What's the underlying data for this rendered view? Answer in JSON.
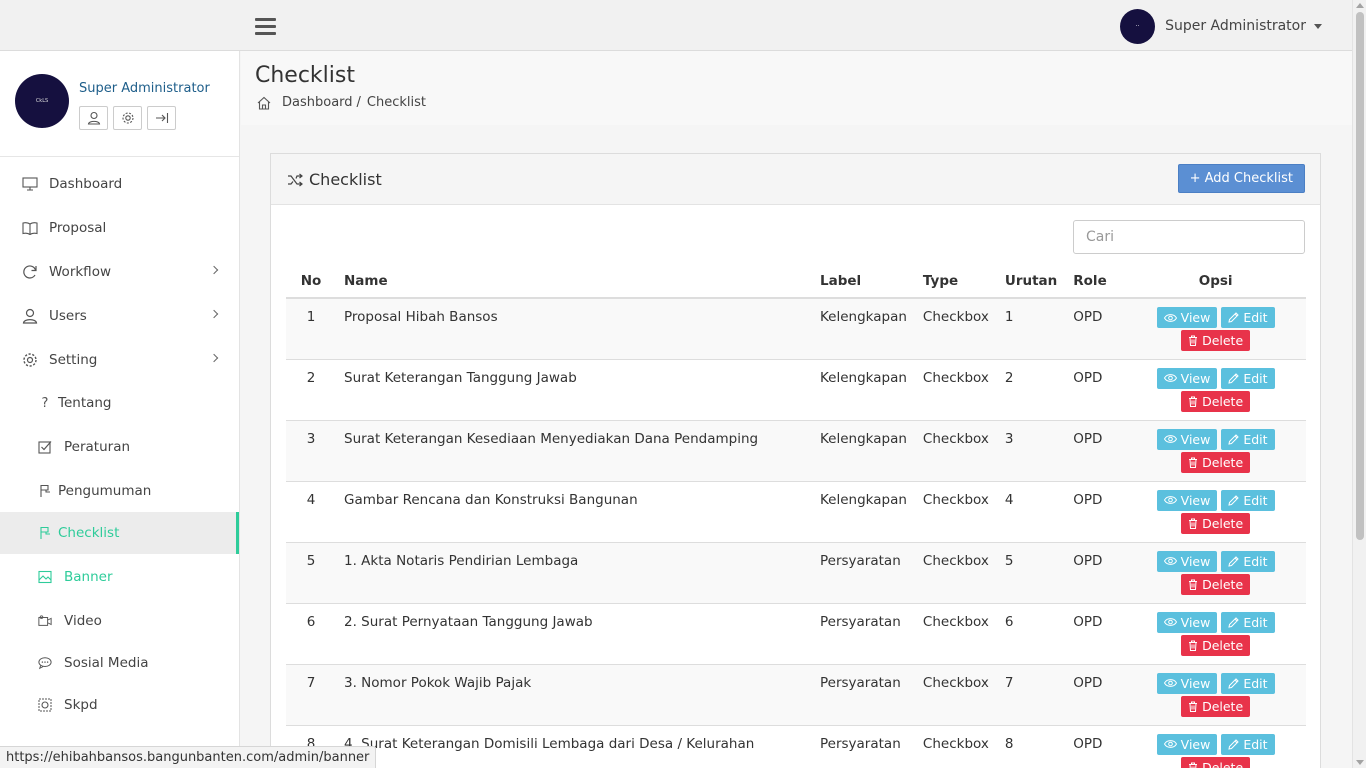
{
  "header": {
    "user_name": "Super Administrator",
    "avatar_text": "··"
  },
  "sidebar": {
    "profile_name": "Super Administrator",
    "avatar_text": "CkLS",
    "items": [
      {
        "label": "Dashboard",
        "icon": "monitor-icon"
      },
      {
        "label": "Proposal",
        "icon": "book-icon"
      },
      {
        "label": "Workflow",
        "icon": "refresh-icon",
        "has_children": true
      },
      {
        "label": "Users",
        "icon": "user-icon",
        "has_children": true
      },
      {
        "label": "Setting",
        "icon": "gear-icon",
        "has_children": true
      }
    ],
    "sub_items": [
      {
        "label": "Tentang",
        "icon": "question-icon"
      },
      {
        "label": "Peraturan",
        "icon": "checkbox-icon"
      },
      {
        "label": "Pengumuman",
        "icon": "flag-icon"
      },
      {
        "label": "Checklist",
        "icon": "flag-icon",
        "active": true
      },
      {
        "label": "Banner",
        "icon": "image-icon"
      },
      {
        "label": "Video",
        "icon": "video-icon"
      },
      {
        "label": "Sosial Media",
        "icon": "chat-icon"
      },
      {
        "label": "Skpd",
        "icon": "target-icon"
      }
    ]
  },
  "page": {
    "title": "Checklist",
    "breadcrumb": {
      "home": "Dashboard",
      "separator": "/",
      "current": "Checklist"
    }
  },
  "panel": {
    "title": "Checklist",
    "add_button": "+ Add Checklist",
    "search_placeholder": "Cari"
  },
  "table": {
    "headers": {
      "no": "No",
      "name": "Name",
      "label": "Label",
      "type": "Type",
      "urutan": "Urutan",
      "role": "Role",
      "opsi": "Opsi"
    },
    "action_labels": {
      "view": "View",
      "edit": "Edit",
      "delete": "Delete"
    },
    "rows": [
      {
        "no": "1",
        "name": "Proposal Hibah Bansos",
        "label": "Kelengkapan",
        "type": "Checkbox",
        "urutan": "1",
        "role": "OPD"
      },
      {
        "no": "2",
        "name": "Surat Keterangan Tanggung Jawab",
        "label": "Kelengkapan",
        "type": "Checkbox",
        "urutan": "2",
        "role": "OPD"
      },
      {
        "no": "3",
        "name": "Surat Keterangan Kesediaan Menyediakan Dana Pendamping",
        "label": "Kelengkapan",
        "type": "Checkbox",
        "urutan": "3",
        "role": "OPD"
      },
      {
        "no": "4",
        "name": "Gambar Rencana dan Konstruksi Bangunan",
        "label": "Kelengkapan",
        "type": "Checkbox",
        "urutan": "4",
        "role": "OPD"
      },
      {
        "no": "5",
        "name": "1. Akta Notaris Pendirian Lembaga",
        "label": "Persyaratan",
        "type": "Checkbox",
        "urutan": "5",
        "role": "OPD"
      },
      {
        "no": "6",
        "name": "2. Surat Pernyataan Tanggung Jawab",
        "label": "Persyaratan",
        "type": "Checkbox",
        "urutan": "6",
        "role": "OPD"
      },
      {
        "no": "7",
        "name": "3. Nomor Pokok Wajib Pajak",
        "label": "Persyaratan",
        "type": "Checkbox",
        "urutan": "7",
        "role": "OPD"
      },
      {
        "no": "8",
        "name": "4. Surat Keterangan Domisili Lembaga dari Desa / Kelurahan",
        "label": "Persyaratan",
        "type": "Checkbox",
        "urutan": "8",
        "role": "OPD"
      }
    ]
  },
  "status_bar": {
    "url": "https://ehibahbansos.bangunbanten.com/admin/banner"
  },
  "colors": {
    "accent": "#2ecc9a",
    "primary_button": "#5b8fd3",
    "info_button": "#5bc0de",
    "danger_button": "#e8334a",
    "avatar": "#15103f"
  }
}
